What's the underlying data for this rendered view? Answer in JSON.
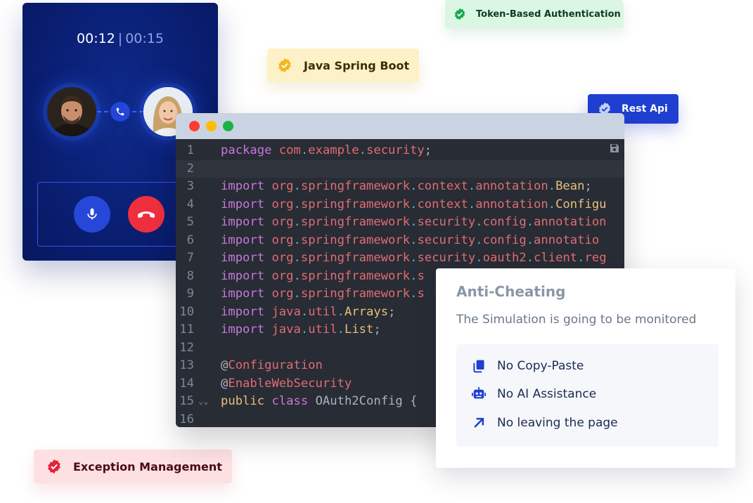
{
  "call": {
    "elapsed": "00:12",
    "separator": "|",
    "total": "00:15"
  },
  "tags": {
    "token_auth": "Token-Based Authentication",
    "java_spring": "Java Spring Boot",
    "rest_api": "Rest Api",
    "exception": "Exception Management"
  },
  "editor": {
    "lines": [
      {
        "n": "1"
      },
      {
        "n": "2"
      },
      {
        "n": "3"
      },
      {
        "n": "4"
      },
      {
        "n": "5"
      },
      {
        "n": "6"
      },
      {
        "n": "7"
      },
      {
        "n": "8"
      },
      {
        "n": "9"
      },
      {
        "n": "10"
      },
      {
        "n": "11"
      },
      {
        "n": "12"
      },
      {
        "n": "13"
      },
      {
        "n": "14"
      },
      {
        "n": "15"
      },
      {
        "n": "16"
      }
    ],
    "fold_marker": "⌄⌄",
    "tokens": {
      "package": "package",
      "import": "import",
      "public": "public",
      "class": "class",
      "com": "com",
      "example": "example",
      "security": "security",
      "org": "org",
      "springframework": "springframework",
      "context": "context",
      "annotation": "annotation",
      "Bean": "Bean",
      "Configu": "Configu",
      "config": "config",
      "annotation_trunc": "annotation",
      "annotatio": "annotatio",
      "oauth2": "oauth2",
      "client": "client",
      "reg": "reg",
      "s": "s",
      "java": "java",
      "util": "util",
      "Arrays": "Arrays",
      "List": "List",
      "at": "@",
      "Configuration": "Configuration",
      "EnableWebSecurity": "EnableWebSecurity",
      "OAuth2Config": "OAuth2Config",
      "brace": "{",
      "dot": ".",
      "semi": ";"
    }
  },
  "anti_cheating": {
    "title": "Anti-Cheating",
    "subtitle": "The Simulation is going to be monitored",
    "rules": [
      {
        "icon": "copy-icon",
        "label": "No Copy-Paste"
      },
      {
        "icon": "robot-icon",
        "label": "No AI Assistance"
      },
      {
        "icon": "arrow-up-right-icon",
        "label": "No leaving the page"
      }
    ]
  },
  "colors": {
    "call_bg": "#0a1f73",
    "accent_blue": "#1f3fd1",
    "end_call_red": "#ef2f3e",
    "token_green": "#1aa851",
    "java_gold": "#f3b81c",
    "exception_red": "#e5213a"
  }
}
